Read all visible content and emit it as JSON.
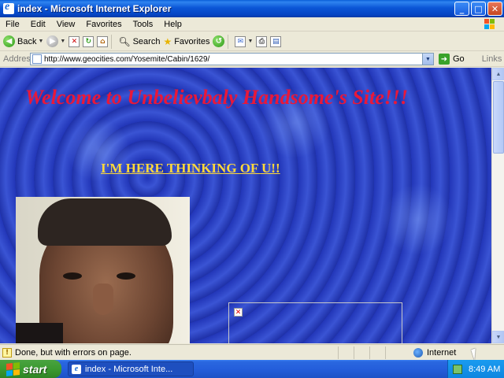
{
  "window": {
    "title": "index - Microsoft Internet Explorer",
    "minimize": "_",
    "maximize": "□",
    "close": "✕"
  },
  "menu": [
    "File",
    "Edit",
    "View",
    "Favorites",
    "Tools",
    "Help"
  ],
  "toolbar": {
    "back_label": "Back",
    "search_label": "Search",
    "favorites_label": "Favorites"
  },
  "address": {
    "label": "Address",
    "url": "http://www.geocities.com/Yosemite/Cabin/1629/",
    "go_label": "Go",
    "links_label": "Links"
  },
  "page": {
    "heading": "Welcome to Unbelievbaly Handsome's Site!!!",
    "subheading": "I'M HERE THINKING OF U!!"
  },
  "status": {
    "text": "Done, but with errors on page.",
    "zone": "Internet"
  },
  "taskbar": {
    "start_label": "start",
    "task_label": "index - Microsoft Inte...",
    "clock": "8:49 AM"
  },
  "colors": {
    "heading": "#e8183a",
    "subheading": "#ffd93a",
    "page_background": "#2a3ec0"
  }
}
